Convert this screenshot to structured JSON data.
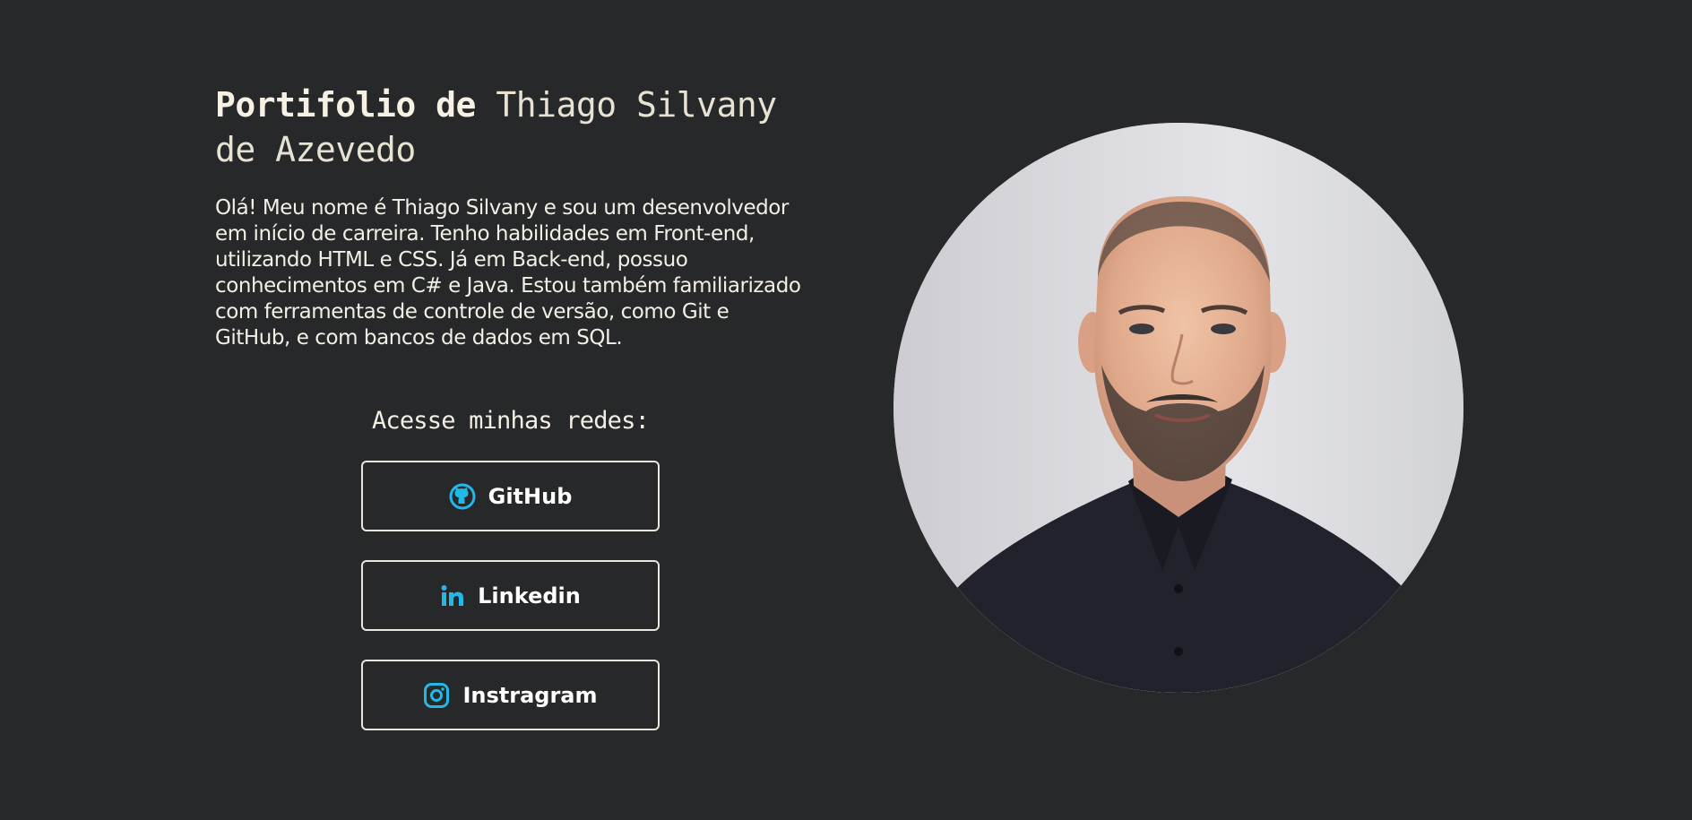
{
  "intro": {
    "title_lead": "Portifolio de",
    "title_name": "Thiago Silvany de Azevedo",
    "bio": "Olá! Meu nome é Thiago Silvany e sou um desenvolvedor em início de carreira. Tenho habilidades em Front-end, utilizando HTML e CSS. Já em Back-end, possuo conhecimentos em C# e Java. Estou também familiarizado com ferramentas de controle de versão, como Git e GitHub, e com bancos de dados em SQL."
  },
  "socials": {
    "heading": "Acesse minhas redes:",
    "links": [
      {
        "label": "GitHub",
        "icon": "github-icon"
      },
      {
        "label": "Linkedin",
        "icon": "linkedin-icon"
      },
      {
        "label": "Instragram",
        "icon": "instagram-icon"
      }
    ]
  },
  "colors": {
    "background": "#272829",
    "accent": "#22b8e8",
    "text": "#f3f0e6",
    "button_border": "#e9e6df"
  }
}
